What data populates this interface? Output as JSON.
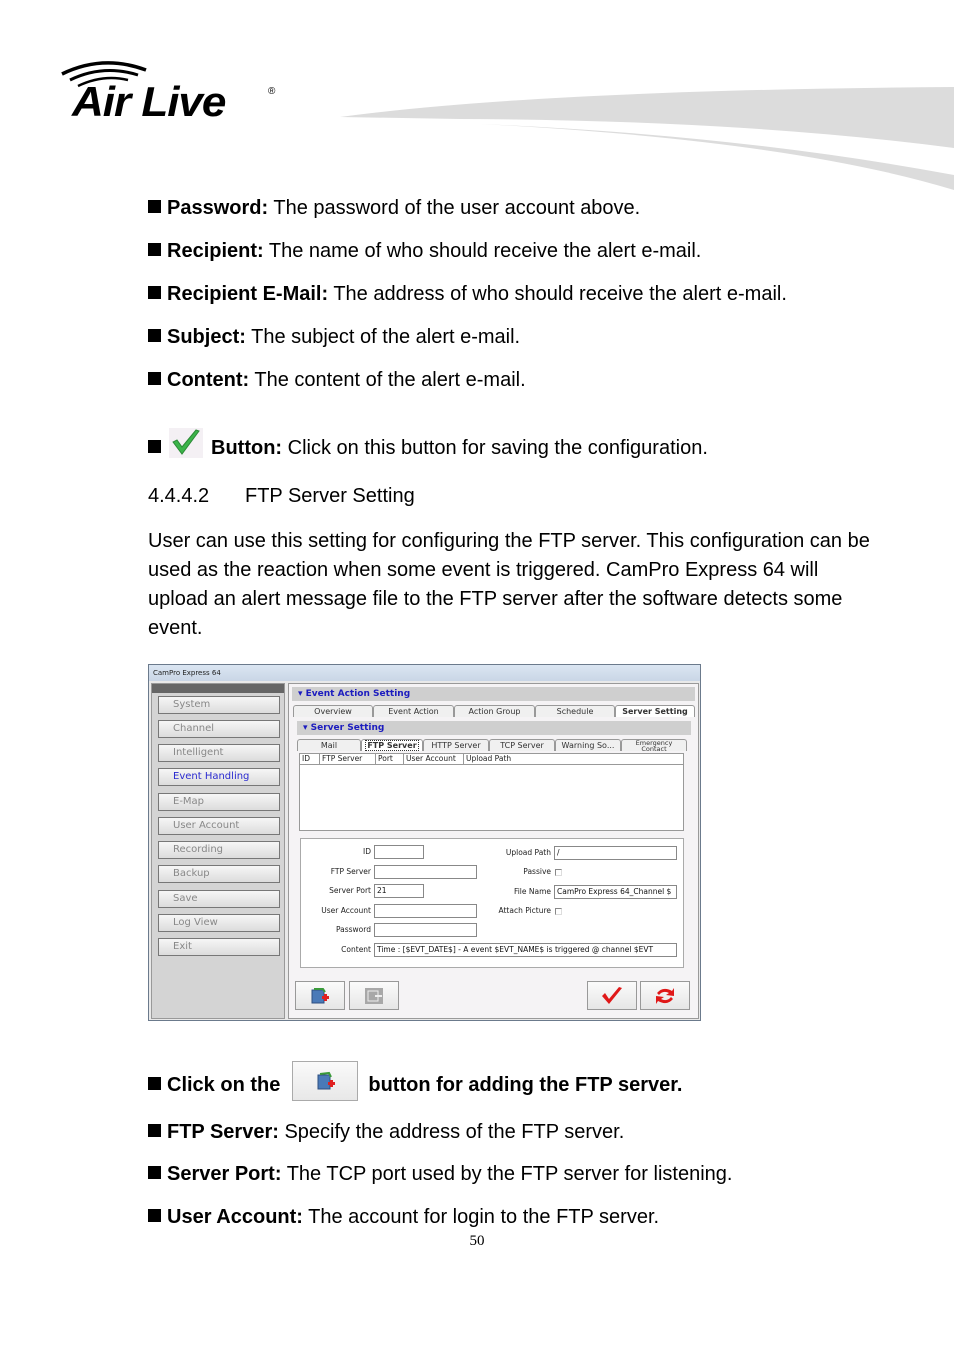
{
  "header": {
    "brand": "Air Live",
    "registered_mark": "®"
  },
  "bullets_top": [
    {
      "term": "Password:",
      "desc": " The password of the user account above."
    },
    {
      "term": "Recipient:",
      "desc": " The name of who should receive the alert e-mail."
    },
    {
      "term": "Recipient E-Mail:",
      "desc": " The address of who should receive the alert e-mail."
    },
    {
      "term": "Subject:",
      "desc": " The subject of the alert e-mail."
    },
    {
      "term": "Content:",
      "desc": " The content of the alert e-mail."
    }
  ],
  "button_bullet": {
    "icon": "green-check-icon",
    "term": "Button:",
    "desc": " Click on this button for saving the configuration."
  },
  "section": {
    "number": "4.4.4.2",
    "title": "FTP Server Setting"
  },
  "paragraph": "User can use this setting for configuring the FTP server. This configuration can be used as the reaction when some event is triggered. CamPro Express 64 will upload an alert message file to the FTP server after the software detects some event.",
  "app": {
    "title": "CamPro Express 64",
    "sidebar": [
      {
        "label": "System",
        "active": false
      },
      {
        "label": "Channel",
        "active": false
      },
      {
        "label": "Intelligent",
        "active": false
      },
      {
        "label": "Event Handling",
        "active": true
      },
      {
        "label": "E-Map",
        "active": false
      },
      {
        "label": "User Account",
        "active": false
      },
      {
        "label": "Recording",
        "active": false
      },
      {
        "label": "Backup",
        "active": false
      },
      {
        "label": "Save",
        "active": false
      },
      {
        "label": "Log View",
        "active": false
      },
      {
        "label": "Exit",
        "active": false
      }
    ],
    "event_action_header": "Event Action Setting",
    "main_tabs": [
      "Overview",
      "Event Action",
      "Action Group",
      "Schedule",
      "Server Setting"
    ],
    "main_tab_active": "Server Setting",
    "server_setting_header": "Server Setting",
    "server_tabs": [
      "Mail",
      "FTP Server",
      "HTTP Server",
      "TCP Server",
      "Warning So...",
      "Emergency Contact"
    ],
    "server_tab_active": "FTP Server",
    "grid_columns": [
      "ID",
      "FTP Server",
      "Port",
      "User Account",
      "Upload Path"
    ],
    "form": {
      "id_label": "ID",
      "id_value": "",
      "ftp_server_label": "FTP Server",
      "ftp_server_value": "",
      "server_port_label": "Server Port",
      "server_port_value": "21",
      "user_account_label": "User Account",
      "user_account_value": "",
      "password_label": "Password",
      "password_value": "",
      "content_label": "Content",
      "content_value": "Time : [$EVT_DATE$] - A event $EVT_NAME$ is triggered @ channel $EVT",
      "upload_path_label": "Upload Path",
      "upload_path_value": "/",
      "passive_label": "Passive",
      "passive_checked": false,
      "file_name_label": "File Name",
      "file_name_value": "CamPro Express 64_Channel $",
      "attach_picture_label": "Attach Picture",
      "attach_picture_checked": false
    },
    "toolbar": {
      "add_icon": "add-ftp-server-icon",
      "delete_icon": "delete-ftp-server-icon",
      "save_icon": "red-check-icon",
      "refresh_icon": "refresh-icon"
    }
  },
  "click_bullet": {
    "pre": "Click on the",
    "post": "button for adding the FTP server."
  },
  "bullets_bottom": [
    {
      "term": "FTP Server:",
      "desc": " Specify the address of the FTP server."
    },
    {
      "term": "Server Port:",
      "desc": " The TCP port used by the FTP server for listening."
    },
    {
      "term": "User Account:",
      "desc": " The account for login to the FTP server."
    }
  ],
  "page_number": "50"
}
